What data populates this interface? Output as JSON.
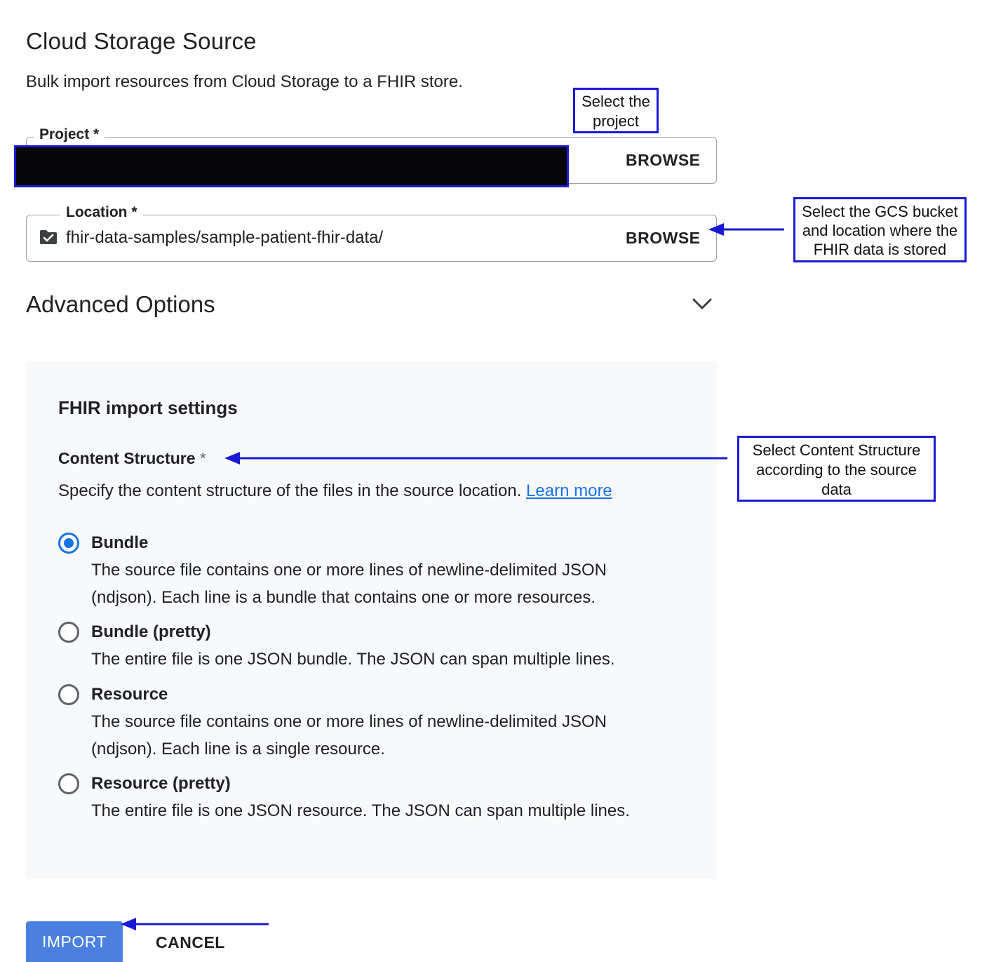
{
  "page": {
    "title": "Cloud Storage Source",
    "subtitle": "Bulk import resources from Cloud Storage to a FHIR store."
  },
  "project": {
    "label": "Project *",
    "browse_label": "BROWSE"
  },
  "location": {
    "label": "Location *",
    "value": "fhir-data-samples/sample-patient-fhir-data/",
    "browse_label": "BROWSE",
    "icon": "folder-check-icon"
  },
  "advanced": {
    "label": "Advanced Options",
    "icon": "chevron-down-icon"
  },
  "import_settings": {
    "title": "FHIR import settings",
    "content_structure_label": "Content Structure",
    "required_marker": "*",
    "description": "Specify the content structure of the files in the source location.",
    "learn_more": "Learn more",
    "options": [
      {
        "label": "Bundle",
        "description": "The source file contains one or more lines of newline-delimited JSON (ndjson). Each line is a bundle that contains one or more resources.",
        "selected": true
      },
      {
        "label": "Bundle (pretty)",
        "description": "The entire file is one JSON bundle. The JSON can span multiple lines.",
        "selected": false
      },
      {
        "label": "Resource",
        "description": "The source file contains one or more lines of newline-delimited JSON (ndjson). Each line is a single resource.",
        "selected": false
      },
      {
        "label": "Resource (pretty)",
        "description": "The entire file is one JSON resource. The JSON can span multiple lines.",
        "selected": false
      }
    ]
  },
  "actions": {
    "import_label": "IMPORT",
    "cancel_label": "CANCEL"
  },
  "annotations": {
    "project_line1": "Select the",
    "project_line2": "project",
    "location_line1": "Select the GCS bucket",
    "location_line2": "and location where the",
    "location_line3": "FHIR data is stored",
    "content_line1": "Select Content Structure",
    "content_line2": "according to the source",
    "content_line3": "data"
  },
  "colors": {
    "accent": "#1a73e8",
    "annotation": "#1a1ad6",
    "import_button": "#4a7fe0",
    "panel_bg": "#f8f9fa"
  }
}
